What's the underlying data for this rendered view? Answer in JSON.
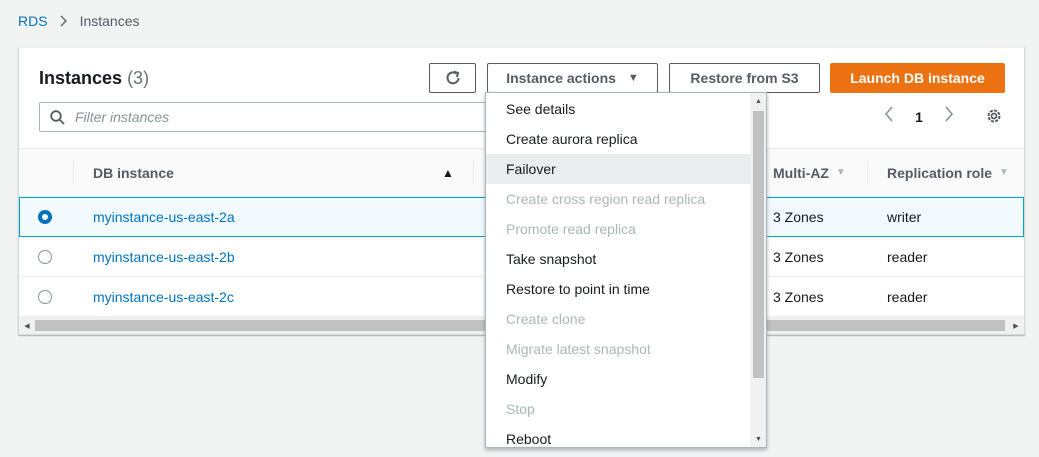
{
  "breadcrumb": {
    "root": "RDS",
    "current": "Instances"
  },
  "panel": {
    "title": "Instances",
    "count": "(3)",
    "refresh_icon": "refresh-icon",
    "actions_label": "Instance actions",
    "restore_label": "Restore from S3",
    "launch_label": "Launch DB instance",
    "filter_placeholder": "Filter instances",
    "page": "1"
  },
  "table": {
    "columns": {
      "db_instance": "DB instance",
      "multi_az": "Multi-AZ",
      "replication_role": "Replication role"
    },
    "rows": [
      {
        "name": "myinstance-us-east-2a",
        "multi_az": "3 Zones",
        "role": "writer",
        "selected": true
      },
      {
        "name": "myinstance-us-east-2b",
        "multi_az": "3 Zones",
        "role": "reader",
        "selected": false
      },
      {
        "name": "myinstance-us-east-2c",
        "multi_az": "3 Zones",
        "role": "reader",
        "selected": false
      }
    ]
  },
  "menu": {
    "items": [
      {
        "label": "See details",
        "disabled": false
      },
      {
        "label": "Create aurora replica",
        "disabled": false
      },
      {
        "label": "Failover",
        "disabled": false,
        "hover": true
      },
      {
        "label": "Create cross region read replica",
        "disabled": true
      },
      {
        "label": "Promote read replica",
        "disabled": true
      },
      {
        "label": "Take snapshot",
        "disabled": false
      },
      {
        "label": "Restore to point in time",
        "disabled": false
      },
      {
        "label": "Create clone",
        "disabled": true
      },
      {
        "label": "Migrate latest snapshot",
        "disabled": true
      },
      {
        "label": "Modify",
        "disabled": false
      },
      {
        "label": "Stop",
        "disabled": true
      },
      {
        "label": "Reboot",
        "disabled": false
      }
    ]
  },
  "colors": {
    "accent": "#0073bb",
    "primary_button": "#ec7211",
    "selected_row_bg": "#f1faff"
  }
}
